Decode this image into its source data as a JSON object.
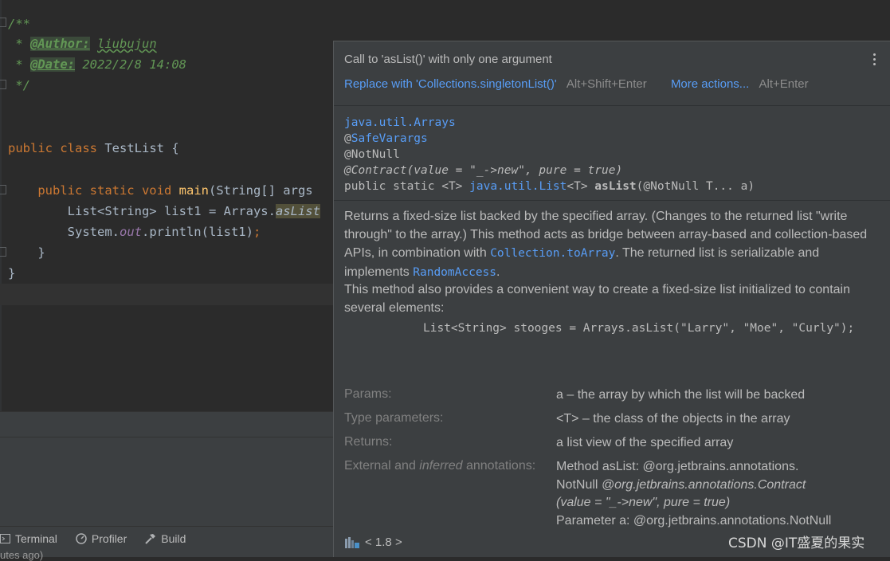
{
  "editor": {
    "comment_open": "/**",
    "author_tag": "@Author:",
    "author_value": "liubujun",
    "date_tag": "@Date:",
    "date_value": "2022/2/8 14:08",
    "comment_close": "*/",
    "class_kw": "public class",
    "class_name": "TestList",
    "brace_open": "{",
    "main_kw": "public static void",
    "main_name": "main",
    "main_params": "(String[] args",
    "stmt1_decl": "List<String> list1 = Arrays.",
    "stmt1_method": "asList",
    "stmt2_prefix": "System.",
    "stmt2_field": "out",
    "stmt2_suffix": ".println(list1)",
    "semicolon": ";",
    "inner_close": "}",
    "outer_close": "}"
  },
  "toolbar": {
    "terminal": "Terminal",
    "profiler": "Profiler",
    "build": "Build"
  },
  "status": {
    "text": "utes ago)"
  },
  "popup": {
    "title": "Call to 'asList()' with only one argument",
    "action_link": "Replace with 'Collections.singletonList()'",
    "action_shortcut": "Alt+Shift+Enter",
    "more_link": "More actions...",
    "more_shortcut": "Alt+Enter",
    "sig_package": "java.util.Arrays",
    "sig_at": "@",
    "sig_safevarargs": "SafeVarargs",
    "sig_notnull": "@NotNull",
    "sig_contract": "@Contract(value = \"_->new\", pure = true)",
    "sig_prefix": "public static <T> ",
    "sig_list": "java.util.List",
    "sig_generic": "<T> ",
    "sig_method": "asList",
    "sig_params": "(@NotNull T... a)",
    "desc1_a": "Returns a fixed-size list backed by the specified array. (Changes to the returned list \"write through\" to the array.) This method acts as bridge between array-based and collection-based APIs, in combination with ",
    "desc1_link1": "Collection.toArray",
    "desc1_b": ". The returned list is serializable and implements ",
    "desc1_link2": "RandomAccess",
    "desc1_c": ".",
    "desc2": "This method also provides a convenient way to create a fixed-size list initialized to contain several elements:",
    "example": "List<String> stooges = Arrays.asList(\"Larry\", \"Moe\", \"Curly\");",
    "params_label": "Params:",
    "params_value": "a – the array by which the list will be backed",
    "type_params_label": "Type parameters:",
    "type_params_value": "<T> – the class of the objects in the array",
    "returns_label": "Returns:",
    "returns_value": "a list view of the specified array",
    "ext_label_a": "External and ",
    "ext_label_em": "inferred",
    "ext_label_b": " annotations:",
    "ext_line1": "Method asList: @org.jetbrains.annotations.",
    "ext_line2a": "NotNull ",
    "ext_line2b": "@org.jetbrains.annotations.Contract",
    "ext_line3": "(value = \"_->new\", pure = true)",
    "ext_line4": "Parameter a: @org.jetbrains.annotations.NotNull",
    "version": "< 1.8 >"
  },
  "watermark": "CSDN @IT盛夏的果实",
  "colors": {
    "editor_bg": "#2b2b2b",
    "panel_bg": "#3c3f41",
    "link": "#589df6",
    "comment": "#629755",
    "keyword": "#cc7832",
    "method": "#ffc66d"
  }
}
